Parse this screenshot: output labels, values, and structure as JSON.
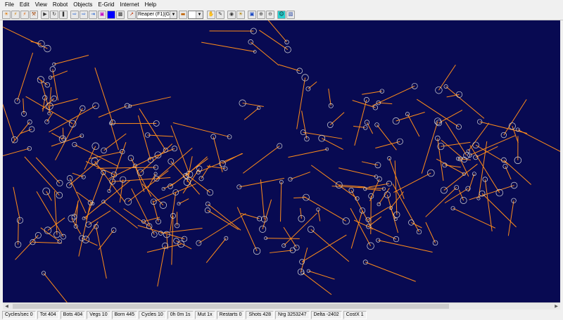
{
  "menu": [
    "File",
    "Edit",
    "View",
    "Robot",
    "Objects",
    "E-Grid",
    "Internet",
    "Help"
  ],
  "toolbar": {
    "robot_select": "Reaper (F1)[Goo",
    "shape_select": "",
    "icons": [
      "new-sim-icon",
      "open-icon",
      "save-icon",
      "settings-icon",
      "play-icon",
      "cycle-icon",
      "pause-icon",
      "step-forward-icon",
      "fast-forward-icon",
      "skip-icon",
      "insert-icon",
      "blue-square-icon",
      "monitor-icon",
      "robot-icon",
      "shape-icon",
      "hand-icon",
      "pointer-icon",
      "camera-icon",
      "team-icon",
      "lock-icon",
      "zoom-in-icon",
      "zoom-out-icon",
      "fit-icon",
      "smiley-icon",
      "network-icon"
    ]
  },
  "status": {
    "cycles_sec": "Cycles/sec 0",
    "tot": "Tot 404",
    "bots": "Bots 404",
    "vegs": "Vegs 10",
    "born": "Born 445",
    "cycles": "Cycles 10",
    "time": "0h 0m 1s",
    "mut": "Mut 1x",
    "restarts": "Restarts 0",
    "shots": "Shots 428",
    "nrg": "Nrg 3253247",
    "delta": "Delta -2402",
    "costx": "CostX 1"
  },
  "colors": {
    "arena_bg": "#080a52",
    "tie_color": "#ff8c1a",
    "bot_color": "#d8d8d8"
  }
}
